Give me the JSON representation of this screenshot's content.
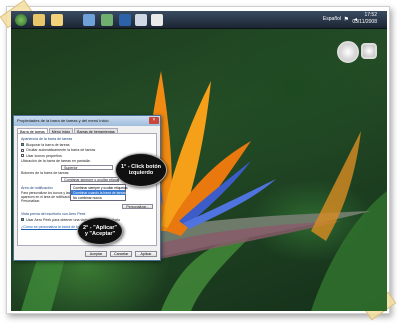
{
  "taskbar": {
    "language": "Español",
    "time": "17:52",
    "date": "03/11/2008"
  },
  "dialog": {
    "title": "Propiedades de la barra de tareas y del menú Inicio",
    "tabs": [
      "Barra de tareas",
      "Menú Inicio",
      "Barras de herramientas"
    ],
    "active_tab": 0,
    "group_appearance": "Apariencia de la barra de tareas",
    "options": [
      {
        "label": "Bloquear la barra de tareas",
        "checked": true
      },
      {
        "label": "Ocultar automáticamente la barra de tareas",
        "checked": false
      },
      {
        "label": "Usar iconos pequeños",
        "checked": false
      }
    ],
    "position_label": "Ubicación de la barra de tareas en pantalla:",
    "position_value": "Superior",
    "buttons_label": "Botones de la barra de tareas:",
    "buttons_value": "Combinar siempre y ocultar etiquetas",
    "group_notification": "Área de notificación",
    "notification_text": "Para personalizar los iconos y las notificaciones que aparecen en el área de notificación, haga clic en Personalizar.",
    "customize_button": "Personalizar...",
    "peek_text": "Vista previa del escritorio con Aero Peek",
    "peek_option": "Usar Aero Peek para obtener una vista previa del escritorio",
    "help_link": "¿Cómo se personaliza la barra de tareas?",
    "ok": "Aceptar",
    "cancel": "Cancelar",
    "apply": "Aplicar"
  },
  "popup": {
    "items": [
      "Combinar siempre y ocultar etiquetas",
      "Combinar cuando la barra de tareas está llena",
      "No combinar nunca"
    ],
    "highlight": 1
  },
  "callouts": {
    "step1": "1° - Click botón izquierdo",
    "step2": "2° - \"Aplicar\" y \"Aceptar\""
  },
  "colors": {
    "callout_bg": "#101010",
    "selection": "#3a7bd5",
    "taskbar": "#1b2533"
  }
}
